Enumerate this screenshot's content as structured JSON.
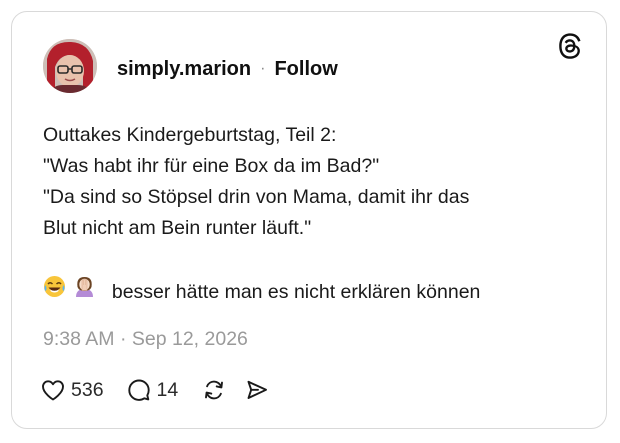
{
  "post": {
    "author": {
      "username": "simply.marion",
      "separator": "·",
      "follow_label": "Follow",
      "avatar_icon": "profile-photo"
    },
    "platform_icon": "threads-logo-icon",
    "text_lines": [
      "Outtakes Kindergeburtstag, Teil 2:",
      "\"Was habt ihr für eine Box da im Bad?\"",
      "\"Da sind so Stöpsel drin von Mama, damit ihr das",
      "Blut nicht am Bein runter läuft.\""
    ],
    "emoji_line": {
      "emojis": [
        "😂",
        "🤦🏻‍♀️"
      ],
      "text": "besser hätte man es nicht erklären können"
    },
    "timestamp": "9:38 AM · Sep 12, 2026",
    "actions": {
      "likes": "536",
      "replies": "14",
      "like_icon": "heart-icon",
      "reply_icon": "comment-icon",
      "repost_icon": "repost-icon",
      "share_icon": "share-icon"
    }
  },
  "colors": {
    "text": "#1a1a1a",
    "muted": "#9a9a9a",
    "border": "#d9d9d9"
  }
}
